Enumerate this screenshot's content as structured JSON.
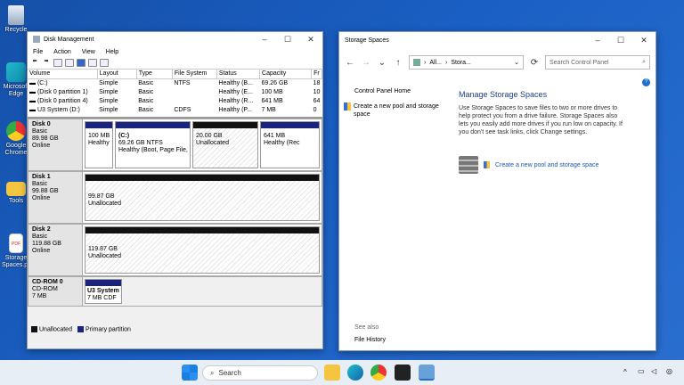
{
  "desktop": {
    "icons": [
      {
        "label": "Recycle"
      },
      {
        "label": "Microsoft Edge"
      },
      {
        "label": "Google Chrome"
      },
      {
        "label": "Tools"
      },
      {
        "label": "Storage Spaces.pdf"
      }
    ]
  },
  "disk_management": {
    "title": "Disk Management",
    "menu": [
      "File",
      "Action",
      "View",
      "Help"
    ],
    "columns": [
      "Volume",
      "Layout",
      "Type",
      "File System",
      "Status",
      "Capacity",
      "Fr"
    ],
    "volumes": [
      [
        "(C:)",
        "Simple",
        "Basic",
        "NTFS",
        "Healthy (B...",
        "69.26 GB",
        "18"
      ],
      [
        "(Disk 0 partition 1)",
        "Simple",
        "Basic",
        "",
        "Healthy (E...",
        "100 MB",
        "10"
      ],
      [
        "(Disk 0 partition 4)",
        "Simple",
        "Basic",
        "",
        "Healthy (R...",
        "641 MB",
        "64"
      ],
      [
        "U3 System (D:)",
        "Simple",
        "Basic",
        "CDFS",
        "Healthy (P...",
        "7 MB",
        "0"
      ]
    ],
    "disks": [
      {
        "name": "Disk 0",
        "type": "Basic",
        "size": "89.98 GB",
        "status": "Online",
        "parts": [
          {
            "l1": "100 MB",
            "l2": "Healthy",
            "l3": ""
          },
          {
            "l1": "(C:)",
            "l2": "69.26 GB NTFS",
            "l3": "Healthy (Boot, Page File,"
          },
          {
            "l1": "20.00 GB",
            "l2": "Unallocated",
            "l3": ""
          },
          {
            "l1": "641 MB",
            "l2": "Healthy (Rec",
            "l3": ""
          }
        ]
      },
      {
        "name": "Disk 1",
        "type": "Basic",
        "size": "99.88 GB",
        "status": "Online",
        "parts": [
          {
            "l1": "99.87 GB",
            "l2": "Unallocated"
          }
        ]
      },
      {
        "name": "Disk 2",
        "type": "Basic",
        "size": "119.88 GB",
        "status": "Online",
        "parts": [
          {
            "l1": "119.87 GB",
            "l2": "Unallocated"
          }
        ]
      },
      {
        "name": "CD-ROM 0",
        "type": "CD-ROM",
        "size": "7 MB",
        "status": "",
        "parts": [
          {
            "l1": "U3 System",
            "l2": "7 MB CDF"
          }
        ]
      }
    ],
    "legend": {
      "unallocated": "Unallocated",
      "primary": "Primary partition"
    }
  },
  "storage_spaces": {
    "title": "Storage Spaces",
    "breadcrumb": [
      "All...",
      "Stora..."
    ],
    "search_placeholder": "Search Control Panel",
    "left": {
      "home": "Control Panel Home",
      "create": "Create a new pool and storage space",
      "see_also": "See also",
      "history": "File History"
    },
    "heading": "Manage Storage Spaces",
    "description": "Use Storage Spaces to save files to two or more drives to help protect you from a drive failure. Storage Spaces also lets you easily add more drives if you run low on capacity. If you don't see task links, click Change settings.",
    "create_link": "Create a new pool and storage space"
  },
  "taskbar": {
    "search": "Search"
  }
}
